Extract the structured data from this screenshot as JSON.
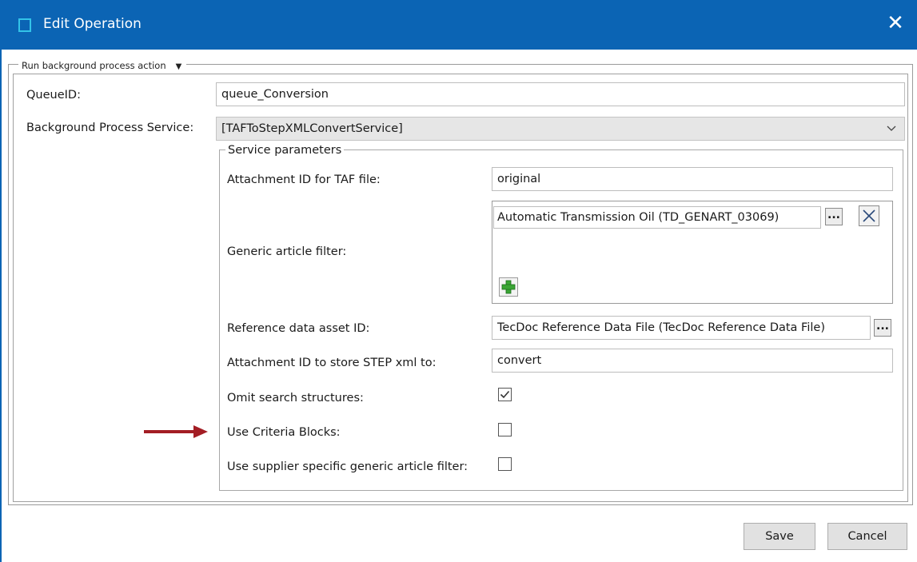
{
  "window": {
    "title": "Edit Operation",
    "close_glyph": "✕",
    "accent_color": "#0b64b4"
  },
  "action_group": {
    "legend": "Run background process action",
    "caret": "▼"
  },
  "fields": {
    "queue_label": "QueueID:",
    "queue_value": "queue_Conversion",
    "service_label": "Background Process Service:",
    "service_value": "[TAFToStepXMLConvertService]"
  },
  "service_parameters": {
    "legend": "Service parameters",
    "taf_label": "Attachment ID for TAF file:",
    "taf_value": "original",
    "filter_label": "Generic article filter:",
    "filter_value": "Automatic Transmission Oil (TD_GENART_03069)",
    "ellipsis": "...",
    "ref_label": "Reference data asset ID:",
    "ref_value": "TecDoc Reference Data File (TecDoc Reference Data File)",
    "step_label": "Attachment ID to store STEP xml to:",
    "step_value": "convert",
    "omit_label": "Omit search structures:",
    "omit_checked": true,
    "criteria_label": "Use Criteria Blocks:",
    "criteria_checked": false,
    "supplier_label": "Use supplier specific generic article filter:",
    "supplier_checked": false
  },
  "annotation": {
    "arrow_color": "#a31d24"
  },
  "buttons": {
    "save": "Save",
    "cancel": "Cancel"
  }
}
